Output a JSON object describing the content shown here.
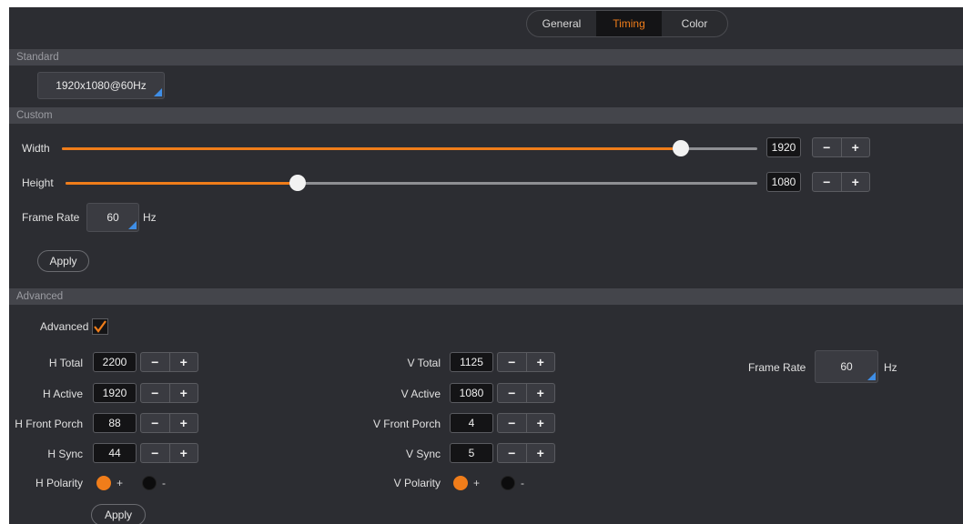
{
  "tabs": [
    {
      "label": "General",
      "active": false
    },
    {
      "label": "Timing",
      "active": true
    },
    {
      "label": "Color",
      "active": false
    }
  ],
  "standard": {
    "section_title": "Standard",
    "selected": "1920x1080@60Hz"
  },
  "custom": {
    "section_title": "Custom",
    "width_label": "Width",
    "width_value": "1920",
    "width_fraction": 0.89,
    "height_label": "Height",
    "height_value": "1080",
    "height_fraction": 0.335,
    "frame_rate_label": "Frame Rate",
    "frame_rate_value": "60",
    "frame_rate_unit": "Hz",
    "apply_label": "Apply"
  },
  "stepper": {
    "minus": "−",
    "plus": "+"
  },
  "advanced": {
    "section_title": "Advanced",
    "checkbox_label": "Advanced",
    "checked": true,
    "h_total_label": "H Total",
    "h_total": "2200",
    "h_active_label": "H Active",
    "h_active": "1920",
    "h_front_porch_label": "H Front Porch",
    "h_front_porch": "88",
    "h_sync_label": "H Sync",
    "h_sync": "44",
    "h_polarity_label": "H Polarity",
    "v_total_label": "V Total",
    "v_total": "1125",
    "v_active_label": "V Active",
    "v_active": "1080",
    "v_front_porch_label": "V Front Porch",
    "v_front_porch": "4",
    "v_sync_label": "V Sync",
    "v_sync": "5",
    "v_polarity_label": "V Polarity",
    "polarity_plus": "+",
    "polarity_minus": "-",
    "frame_rate_label": "Frame Rate",
    "frame_rate_value": "60",
    "frame_rate_unit": "Hz",
    "apply_label": "Apply"
  },
  "colors": {
    "accent": "#f07d1a",
    "corner_marker": "#3f8ee6",
    "panel_bg": "#2c2d32"
  }
}
